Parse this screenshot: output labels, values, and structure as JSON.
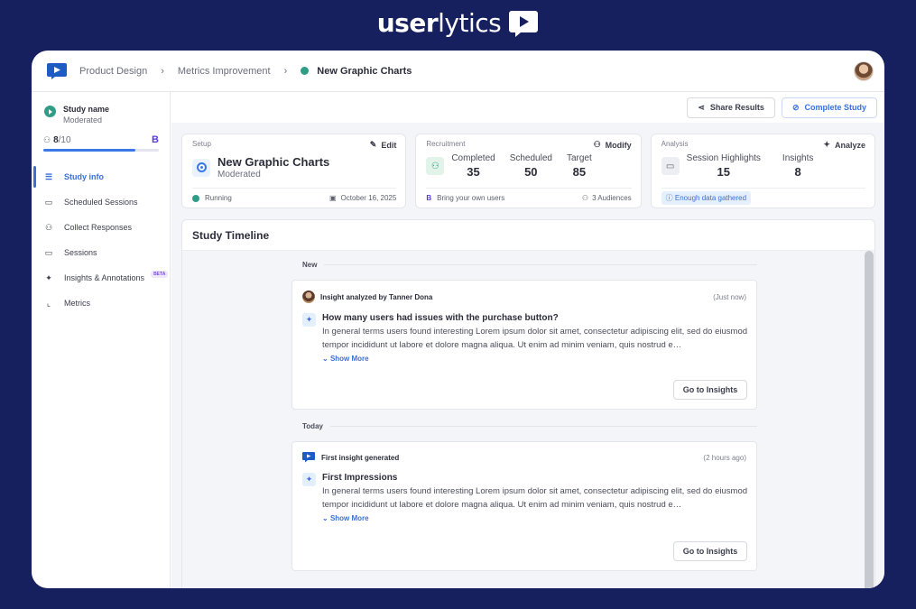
{
  "brand": {
    "bold": "user",
    "light": "lytics"
  },
  "breadcrumb": {
    "items": [
      "Product Design",
      "Metrics Improvement"
    ],
    "current": "New Graphic Charts",
    "sep": "›"
  },
  "sidebar": {
    "study_label": "Study name",
    "study_type": "Moderated",
    "progress": {
      "done": "8",
      "total": "/10",
      "fraction": 0.8,
      "badge": "B"
    },
    "nav": [
      {
        "label": "Study info",
        "icon": "list-icon",
        "glyph": "☰",
        "active": true
      },
      {
        "label": "Scheduled Sessions",
        "icon": "calendar-icon",
        "glyph": "▭",
        "active": false
      },
      {
        "label": "Collect Responses",
        "icon": "people-icon",
        "glyph": "⚇",
        "active": false
      },
      {
        "label": "Sessions",
        "icon": "video-icon",
        "glyph": "▭",
        "active": false
      },
      {
        "label": "Insights & Annotations",
        "icon": "sparkle-icon",
        "glyph": "✦",
        "active": false,
        "badge": "BETA"
      },
      {
        "label": "Metrics",
        "icon": "chart-icon",
        "glyph": "⌞",
        "active": false
      }
    ]
  },
  "toolbar": {
    "share_label": "Share Results",
    "complete_label": "Complete Study"
  },
  "setup": {
    "title": "Setup",
    "action": "Edit",
    "name": "New Graphic Charts",
    "type": "Moderated",
    "status": "Running",
    "date": "October 16, 2025"
  },
  "recruitment": {
    "title": "Recruitment",
    "action": "Modify",
    "stats": [
      {
        "label": "Completed",
        "value": "35"
      },
      {
        "label": "Scheduled",
        "value": "50"
      },
      {
        "label": "Target",
        "value": "85"
      }
    ],
    "byou_badge": "B",
    "byou": "Bring your own users",
    "audiences": "3 Audiences"
  },
  "analysis": {
    "title": "Analysis",
    "action": "Analyze",
    "stats": [
      {
        "label": "Session Highlights",
        "value": "15"
      },
      {
        "label": "Insights",
        "value": "8"
      }
    ],
    "notice": "Enough data gathered"
  },
  "timeline": {
    "title": "Study Timeline",
    "groups": [
      {
        "label": "New",
        "card": {
          "author": "Insight analyzed by Tanner Dona",
          "time": "(Just now)",
          "question": "How many users had issues with the purchase button?",
          "text": "In general terms users found interesting Lorem ipsum dolor sit amet, consectetur adipiscing elit, sed do eiusmod tempor incididunt ut labore et dolore magna aliqua. Ut enim ad minim veniam, quis nostrud e…",
          "show_more": "Show More",
          "button": "Go to Insights"
        }
      },
      {
        "label": "Today",
        "card": {
          "author": "First insight generated",
          "time": "(2 hours ago)",
          "question": "First Impressions",
          "text": "In general terms users found interesting Lorem ipsum dolor sit amet, consectetur adipiscing elit, sed do eiusmod tempor incididunt ut labore et dolore magna aliqua. Ut enim ad minim veniam, quis nostrud e…",
          "show_more": "Show More",
          "button": "Go to Insights"
        }
      }
    ]
  },
  "colors": {
    "background": "#17205e",
    "accent": "#3b6fd8",
    "running": "#2f9d86"
  }
}
